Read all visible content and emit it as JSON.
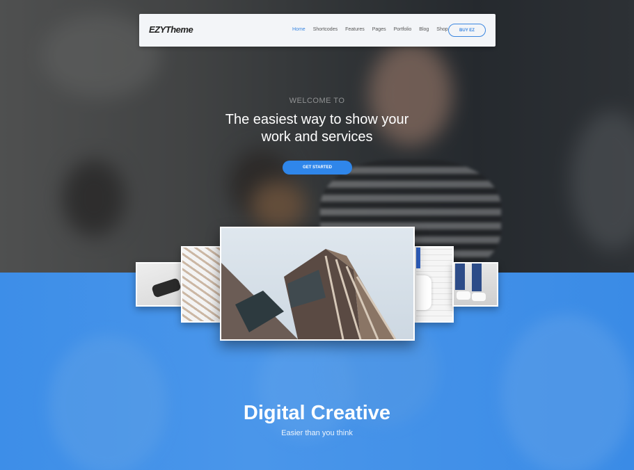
{
  "navbar": {
    "logo": "EZYTheme",
    "menu": [
      "Home",
      "Shortcodes",
      "Features",
      "Pages",
      "Portfolio",
      "Blog",
      "Shop"
    ],
    "active_item": "Home",
    "buy_label": "BUY EZ"
  },
  "hero": {
    "welcome": "WELCOME TO",
    "headline_line1": "The easiest way to show your",
    "headline_line2": "work and services",
    "cta_label": "GET STARTED"
  },
  "section": {
    "title": "Digital Creative",
    "subtitle": "Easier than you think"
  },
  "colors": {
    "accent": "#2f86ea",
    "section_bg": "#3d8ee8",
    "navbar_bg": "#f3f5f8"
  },
  "gallery": {
    "cards": [
      "vr-headset-photo",
      "stairs-photo",
      "building-photo",
      "person-photo",
      "sneakers-photo"
    ]
  }
}
